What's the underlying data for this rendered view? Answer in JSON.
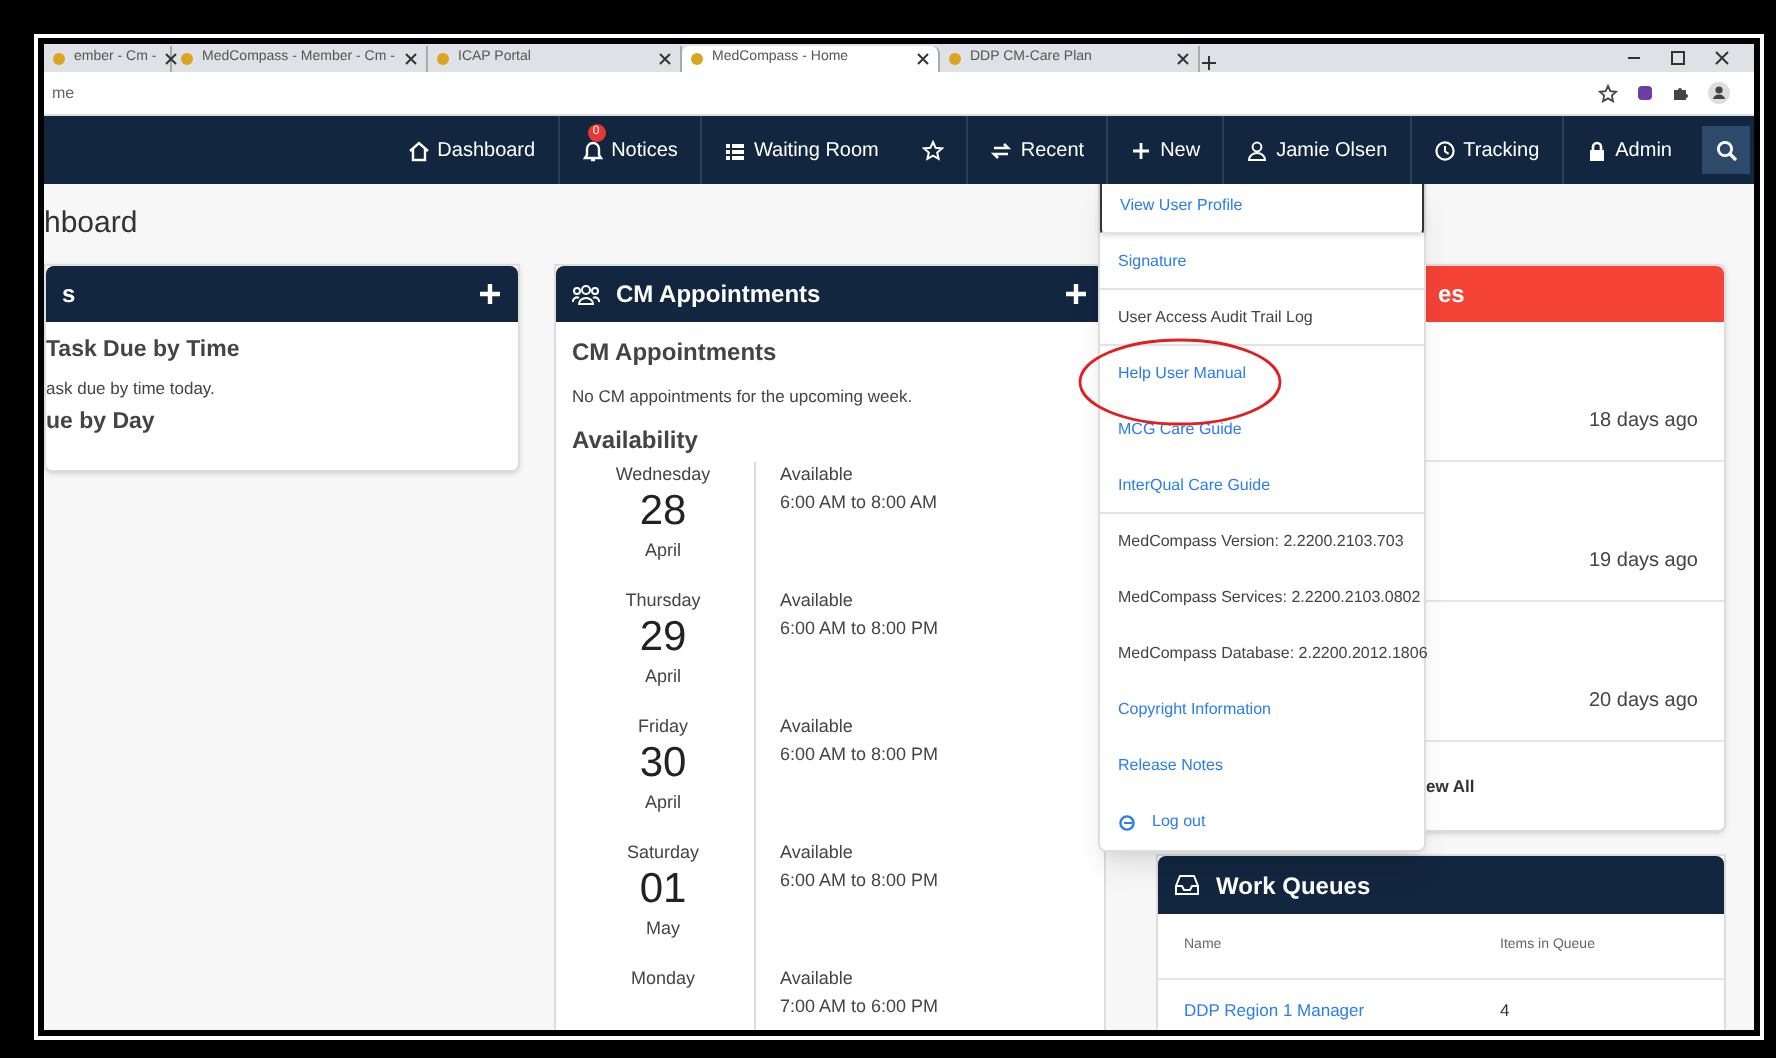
{
  "browser": {
    "tabs": [
      {
        "title": "ember - Cm - ",
        "selected": false
      },
      {
        "title": "MedCompass - Member - Cm - ",
        "selected": false
      },
      {
        "title": "ICAP Portal",
        "selected": false
      },
      {
        "title": "MedCompass - Home",
        "selected": true
      },
      {
        "title": "DDP CM-Care Plan",
        "selected": false
      }
    ],
    "address": "me"
  },
  "nav": {
    "items": [
      {
        "kind": "dashboard",
        "label": "Dashboard"
      },
      {
        "kind": "notices",
        "label": "Notices",
        "badge": "0"
      },
      {
        "kind": "waiting",
        "label": "Waiting Room"
      },
      {
        "kind": "star"
      },
      {
        "kind": "recent",
        "label": "Recent"
      },
      {
        "kind": "new",
        "label": "New"
      },
      {
        "kind": "user",
        "label": "Jamie Olsen"
      },
      {
        "kind": "tracking",
        "label": "Tracking"
      },
      {
        "kind": "admin",
        "label": "Admin"
      }
    ]
  },
  "page_title": "hboard",
  "tasks_card": {
    "title": "s",
    "lines": [
      {
        "kind": "heading",
        "text": "Task Due by Time"
      },
      {
        "kind": "text",
        "text": "ask due by time today."
      },
      {
        "kind": "heading",
        "text": "ue by Day"
      }
    ]
  },
  "appointments_card": {
    "title": "CM Appointments",
    "subtitle": "CM Appointments",
    "message": "No CM appointments for the upcoming week.",
    "availability_title": "Availability",
    "days": [
      {
        "weekday": "Wednesday",
        "date": "28",
        "month": "April",
        "status": "Available",
        "hours": "6:00 AM to 8:00 AM"
      },
      {
        "weekday": "Thursday",
        "date": "29",
        "month": "April",
        "status": "Available",
        "hours": "6:00 AM to 8:00 PM"
      },
      {
        "weekday": "Friday",
        "date": "30",
        "month": "April",
        "status": "Available",
        "hours": "6:00 AM to 8:00 PM"
      },
      {
        "weekday": "Saturday",
        "date": "01",
        "month": "May",
        "status": "Available",
        "hours": "6:00 AM to 8:00 PM"
      },
      {
        "weekday": "Monday",
        "status": "Available",
        "hours": "7:00 AM to 6:00 PM"
      }
    ]
  },
  "alerts_card": {
    "title": "es",
    "rows": [
      {
        "time": "18 days ago"
      },
      {
        "time": "19 days ago"
      },
      {
        "time": "20 days ago"
      }
    ],
    "footer": "ew All"
  },
  "work_queues": {
    "title": "Work Queues",
    "columns": [
      "Name",
      "Items in Queue"
    ],
    "rows": [
      {
        "name": "DDP Region 1 Manager",
        "count": "4"
      }
    ]
  },
  "user_menu": {
    "items": [
      {
        "label": "View User Profile",
        "kind": "link",
        "focused": true,
        "divider": true
      },
      {
        "label": "Signature",
        "kind": "link",
        "focused": false,
        "divider": true
      },
      {
        "label": "User Access Audit Trail Log",
        "kind": "info",
        "focused": false,
        "divider": true
      },
      {
        "label": "Help User Manual",
        "kind": "link",
        "focused": false,
        "divider": false,
        "circled": true
      },
      {
        "label": "MCG Care Guide",
        "kind": "link",
        "focused": false,
        "divider": false
      },
      {
        "label": "InterQual Care Guide",
        "kind": "link",
        "focused": false,
        "divider": true
      },
      {
        "label": "MedCompass Version: 2.2200.2103.703",
        "kind": "info",
        "focused": false,
        "divider": false
      },
      {
        "label": "MedCompass Services: 2.2200.2103.0802",
        "kind": "info",
        "focused": false,
        "divider": false
      },
      {
        "label": "MedCompass Database: 2.2200.2012.1806",
        "kind": "info",
        "focused": false,
        "divider": false
      },
      {
        "label": "Copyright Information",
        "kind": "link",
        "focused": false,
        "divider": false
      },
      {
        "label": "Release Notes",
        "kind": "link",
        "focused": false,
        "divider": false
      },
      {
        "label": "Log out",
        "kind": "logout",
        "focused": false,
        "divider": false
      }
    ]
  }
}
